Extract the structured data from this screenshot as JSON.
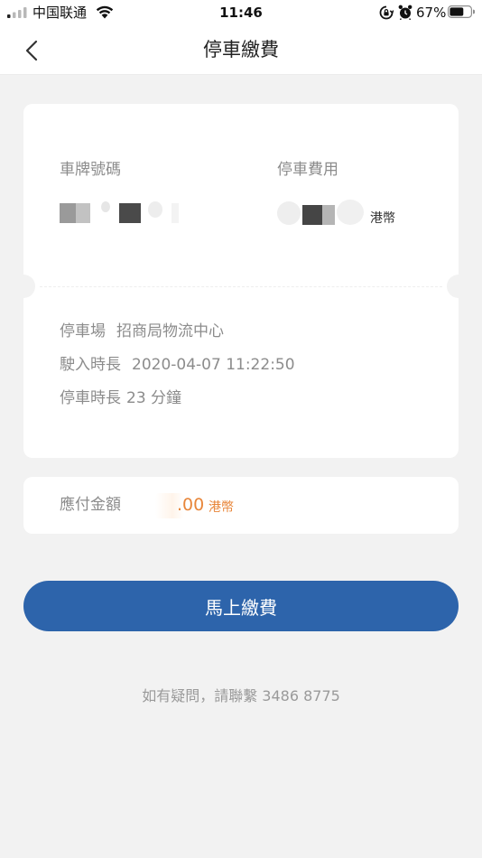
{
  "status_bar": {
    "carrier": "中国联通",
    "time": "11:46",
    "battery_percent": "67%",
    "battery_level": 0.67,
    "icons": [
      "signal-icon",
      "wifi-icon",
      "rotation-lock-icon",
      "alarm-icon",
      "battery-icon"
    ]
  },
  "nav": {
    "back_icon": "chevron-left-icon",
    "title": "停車繳費"
  },
  "ticket": {
    "plate_label": "車牌號碼",
    "plate_value_masked": true,
    "fee_label": "停車費用",
    "fee_value_masked": true,
    "fee_currency": "港幣",
    "lot_label": "停車場",
    "lot_value": "招商局物流中心",
    "entry_label": "駛入時長",
    "entry_value": "2020-04-07 11:22:50",
    "duration_label": "停車時長",
    "duration_value": "23 分鐘"
  },
  "amount": {
    "label": "應付金額",
    "value": ".00",
    "currency": "港幣",
    "accent_color": "#e8863a"
  },
  "pay_button": {
    "label": "馬上繳費",
    "color": "#2d64ab"
  },
  "contact": {
    "text": "如有疑問，請聯繫 3486 8775"
  }
}
